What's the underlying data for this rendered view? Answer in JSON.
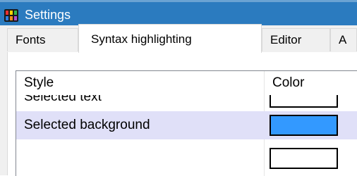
{
  "window": {
    "title": "Settings",
    "icon": "settings-app-icon"
  },
  "tabs": [
    {
      "label": "Fonts",
      "active": false
    },
    {
      "label": "Syntax highlighting",
      "active": true
    },
    {
      "label": "Editor",
      "active": false
    },
    {
      "label": "A",
      "active": false
    }
  ],
  "list": {
    "columns": [
      "Style",
      "Color"
    ],
    "rows": [
      {
        "label": "Selected text",
        "color": "#ffffff",
        "selected": false
      },
      {
        "label": "Selected background",
        "color": "#3399ff",
        "selected": true
      },
      {
        "label": "",
        "color": "#ffffff",
        "selected": false
      }
    ]
  },
  "colors": {
    "titlebar": "#2b7bbf",
    "selection": "#e0e0f8"
  }
}
